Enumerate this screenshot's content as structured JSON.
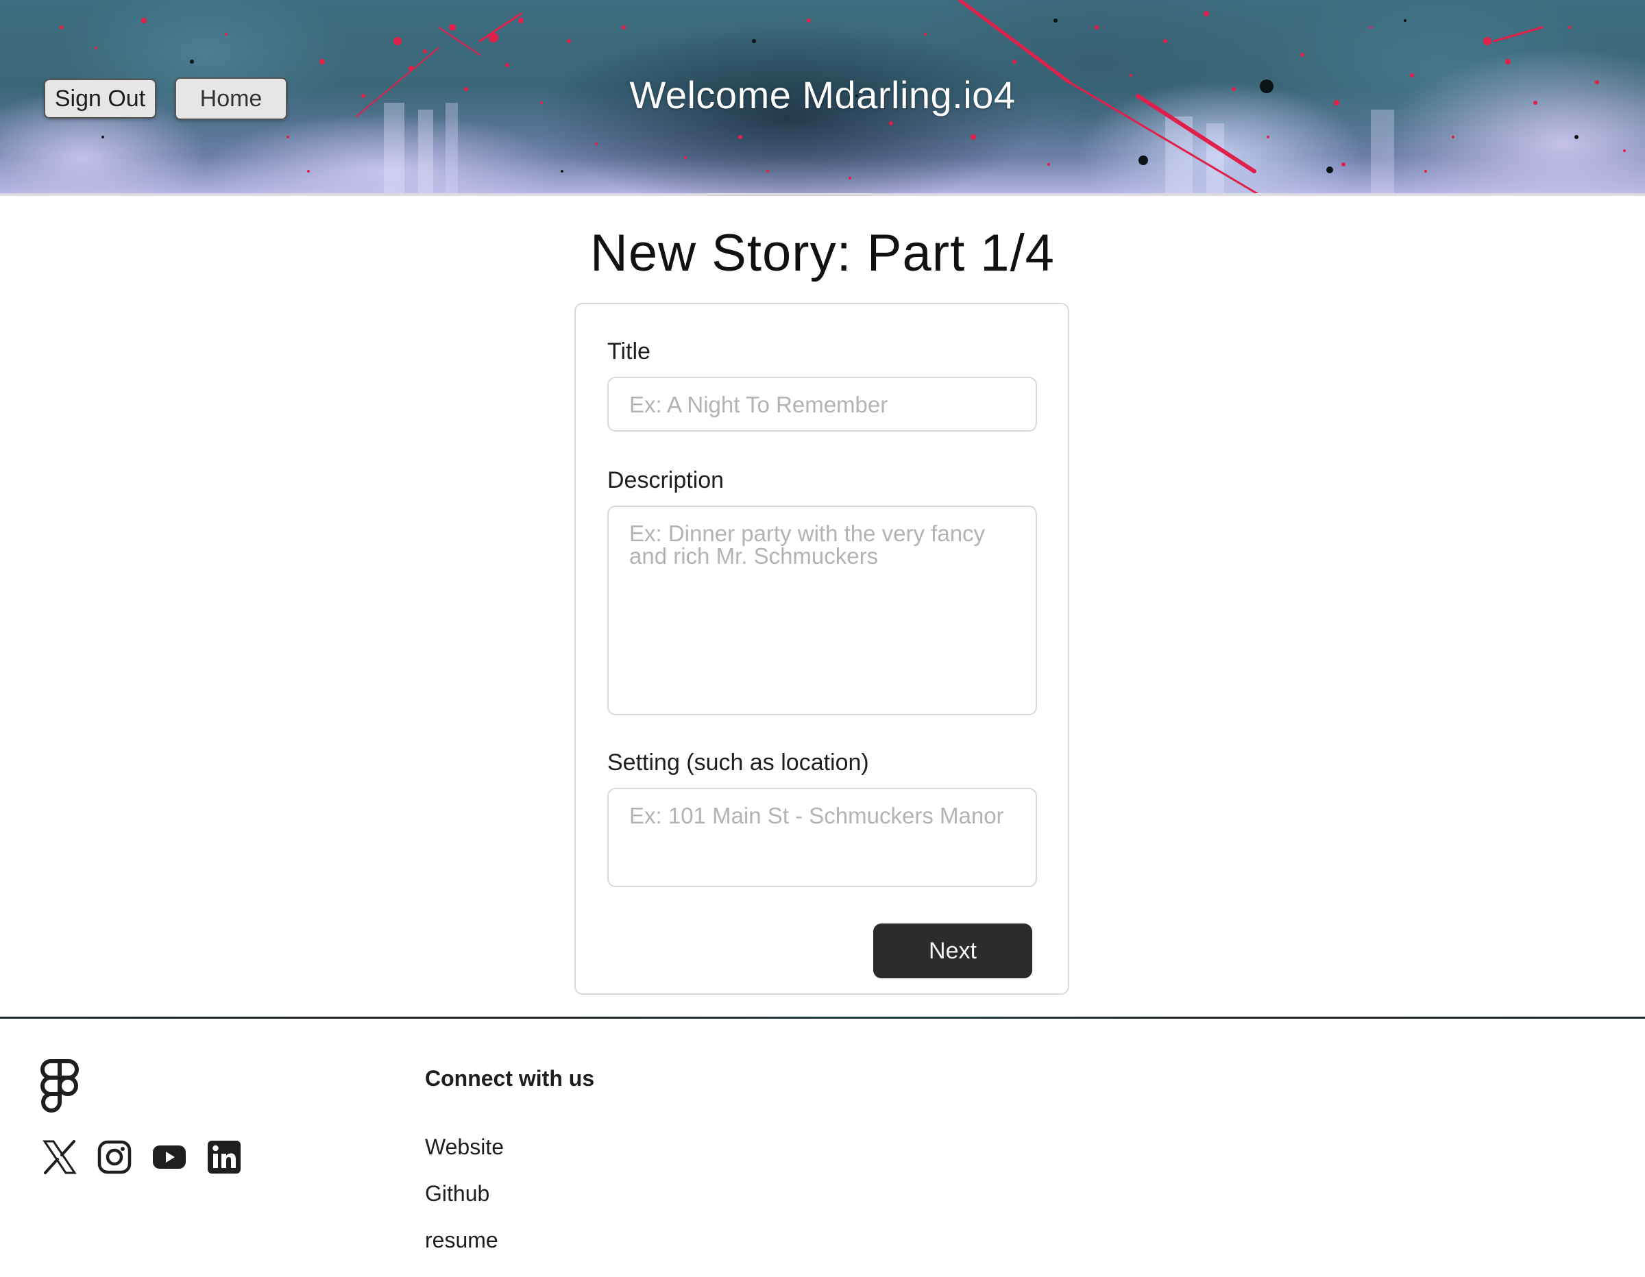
{
  "header": {
    "sign_out_label": "Sign Out",
    "home_label": "Home",
    "welcome_text": "Welcome Mdarling.io4"
  },
  "page": {
    "title": "New Story: Part 1/4"
  },
  "form": {
    "title_label": "Title",
    "title_placeholder": "Ex: A Night To Remember",
    "description_label": "Description",
    "description_placeholder": "Ex: Dinner party with the very fancy and rich Mr. Schmuckers",
    "setting_label": "Setting (such as location)",
    "setting_placeholder": "Ex: 101 Main St - Schmuckers Manor",
    "next_label": "Next"
  },
  "footer": {
    "logo_icon": "figma-logo-icon",
    "social_icons": [
      "x-icon",
      "instagram-icon",
      "youtube-icon",
      "linkedin-icon"
    ],
    "connect_title": "Connect with us",
    "links": [
      "Website",
      "Github",
      "resume"
    ]
  },
  "colors": {
    "next_button_bg": "#2c2c2c",
    "card_border": "#d9d9d9",
    "placeholder_text": "#b3b3b3",
    "banner_splatter": "#e0204a"
  }
}
